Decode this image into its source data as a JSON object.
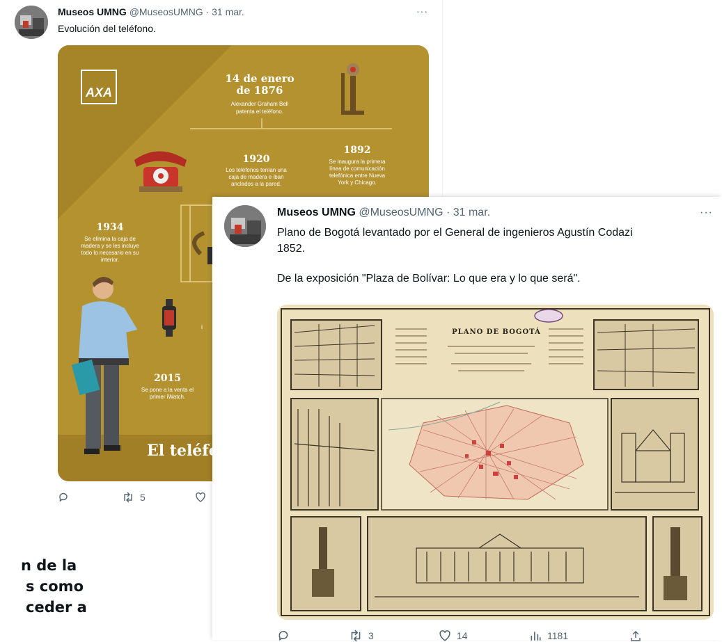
{
  "tweet1": {
    "name": "Museos UMNG",
    "handle_date": "@MuseosUMNG · 31 mar.",
    "text": "Evolución del teléfono.",
    "more": "···",
    "actions": {
      "replies": "",
      "retweets": "5",
      "likes": ""
    },
    "infographic": {
      "logo": "AXA",
      "items": [
        {
          "title": "14 de enero",
          "title2": "de 1876",
          "text": "Alexander Graham Bell",
          "text2": "patenta el teléfono."
        },
        {
          "title": "1920",
          "text": "Los teléfonos tenían una",
          "text2": "caja de madera e iban",
          "text3": "anclados a la pared."
        },
        {
          "title": "1892",
          "text": "Se inaugura la primera",
          "text2": "línea de comunicación",
          "text3": "telefónica entre Nueva",
          "text4": "York y Chicago."
        },
        {
          "title": "1934",
          "text": "Se elimina la caja de",
          "text2": "madera y se les incluye",
          "text3": "todo lo necesario en su",
          "text4": "interior."
        },
        {
          "title": "2015",
          "text": "Se pone a la venta el",
          "text2": "primer iWatch."
        }
      ],
      "footer": "El teléfo",
      "partial": "i"
    }
  },
  "tweet2": {
    "name": "Museos UMNG",
    "handle_date": "@MuseosUMNG · 31 mar.",
    "more": "···",
    "text_line1": "Plano de Bogotá levantado por el General de ingenieros Agustín Codazi",
    "text_line2": "1852.",
    "text_line3": "De la exposición \"Plaza de Bolívar: Lo que era y lo que será\".",
    "map_title": "PLANO DE BOGOTÁ",
    "actions": {
      "replies": "",
      "retweets": "3",
      "likes": "14",
      "views": "1181"
    }
  },
  "background_text": {
    "line1": "n de la",
    "line2": "s como",
    "line3": "ceder a"
  }
}
